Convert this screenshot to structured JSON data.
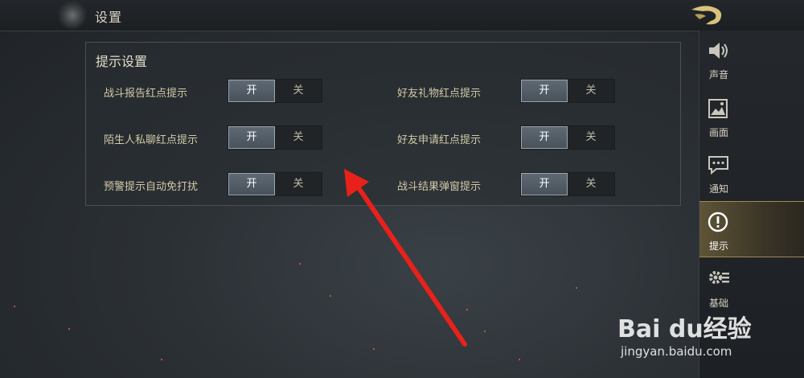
{
  "header": {
    "title": "设置"
  },
  "panel": {
    "title": "提示设置",
    "on_label": "开",
    "off_label": "关",
    "settings": [
      {
        "label": "战斗报告红点提示",
        "state": "开"
      },
      {
        "label": "好友礼物红点提示",
        "state": "开"
      },
      {
        "label": "陌生人私聊红点提示",
        "state": "开"
      },
      {
        "label": "好友申请红点提示",
        "state": "开"
      },
      {
        "label": "预警提示自动免打扰",
        "state": "开"
      },
      {
        "label": "战斗结果弹窗提示",
        "state": "开"
      }
    ]
  },
  "sidebar": {
    "items": [
      {
        "label": "声音",
        "icon": "speaker-icon"
      },
      {
        "label": "画面",
        "icon": "picture-icon"
      },
      {
        "label": "通知",
        "icon": "chat-bubble-icon"
      },
      {
        "label": "提示",
        "icon": "exclamation-circle-icon",
        "active": true
      },
      {
        "label": "基础",
        "icon": "gear-icon"
      }
    ]
  },
  "watermark": {
    "main": "Bai du经验",
    "sub": "jingyan.baidu.com"
  },
  "colors": {
    "accent": "#a08a4e",
    "label": "#d2c9a8",
    "arrow": "#e8211b"
  }
}
